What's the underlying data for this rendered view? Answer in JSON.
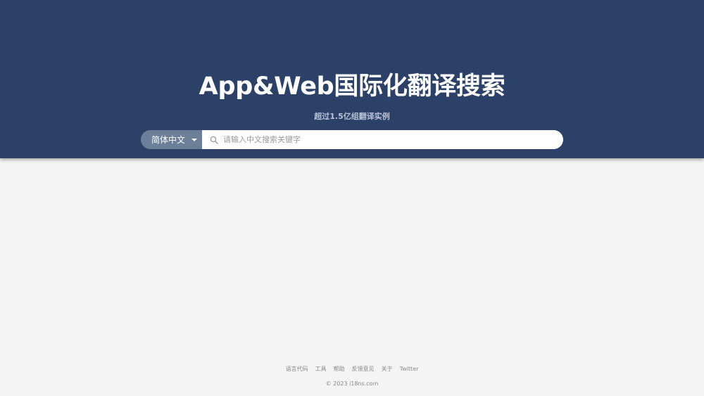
{
  "hero": {
    "title": "App&Web国际化翻译搜索",
    "subtitle": "超过1.5亿组翻译实例"
  },
  "search": {
    "language_selected": "简体中文",
    "placeholder": "请输入中文搜索关键字",
    "value": "",
    "icon": "search-icon",
    "caret_icon": "caret-down-icon"
  },
  "footer": {
    "links": [
      {
        "label": "语言代码"
      },
      {
        "label": "工具"
      },
      {
        "label": "帮助"
      },
      {
        "label": "反馈意见"
      },
      {
        "label": "关于"
      },
      {
        "label": "Twitter"
      }
    ],
    "copyright": "© 2023 i18ns.com"
  },
  "colors": {
    "header_bg": "#2b4168",
    "language_select_bg": "#6c7f98",
    "page_bg": "#f4f4f4"
  }
}
